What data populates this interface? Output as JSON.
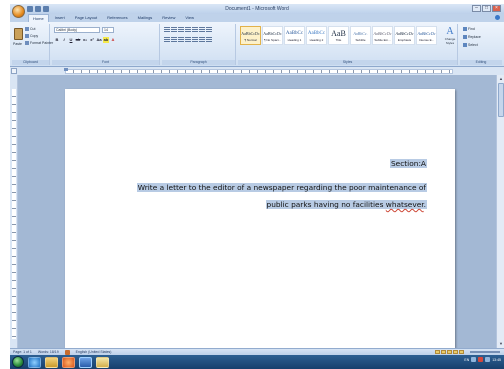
{
  "window": {
    "title": "Document1 - Microsoft Word"
  },
  "tabs": [
    "Home",
    "Insert",
    "Page Layout",
    "References",
    "Mailings",
    "Review",
    "View"
  ],
  "ribbon": {
    "clipboard": {
      "label": "Clipboard",
      "paste": "Paste",
      "cut": "Cut",
      "copy": "Copy",
      "format_painter": "Format Painter"
    },
    "font": {
      "label": "Font",
      "name": "Calibri (Body)",
      "size": "14"
    },
    "paragraph": {
      "label": "Paragraph"
    },
    "styles": {
      "label": "Styles",
      "items": [
        {
          "preview": "AaBbCcDc",
          "name": "¶ Normal"
        },
        {
          "preview": "AaBbCcDc",
          "name": "¶ No Spaci..."
        },
        {
          "preview": "AaBbCc",
          "name": "Heading 1"
        },
        {
          "preview": "AaBbCc",
          "name": "Heading 2"
        },
        {
          "preview": "AaB",
          "name": "Title"
        },
        {
          "preview": "AaBbCc.",
          "name": "Subtitle"
        },
        {
          "preview": "AaBbCcDc",
          "name": "Subtle Em..."
        },
        {
          "preview": "AaBbCcDc",
          "name": "Emphasis"
        },
        {
          "preview": "AaBbCcDc",
          "name": "Intense E..."
        }
      ],
      "change_styles": "Change Styles"
    },
    "editing": {
      "label": "Editing",
      "find": "Find",
      "replace": "Replace",
      "select": "Select"
    }
  },
  "document": {
    "line1": "Section:A",
    "line2": "Write a letter to the editor of a newspaper regarding the poor maintenance of",
    "line3_start": "public parks having no facilities ",
    "line3_misspelled": "whatsever",
    "line3_end": "."
  },
  "status_bar": {
    "page": "Page: 1 of 1",
    "words": "Words: 18/19",
    "language": "English (United States)"
  },
  "taskbar": {
    "language": "EN",
    "clock": "13:45"
  },
  "colors": {
    "selection": "#b8cbe4",
    "ribbon": "#dce8f6",
    "taskbar": "#1f4a7a"
  }
}
